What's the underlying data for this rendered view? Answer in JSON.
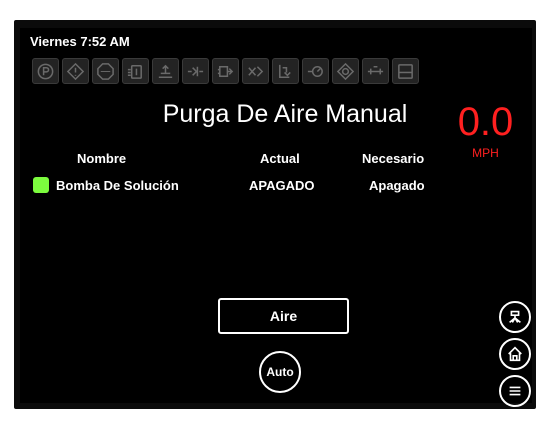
{
  "status_bar": {
    "datetime": "Viernes 7:52 AM"
  },
  "toolbar_icons": [
    "park-icon",
    "warning-icon",
    "stop-icon",
    "tank-agitation-icon",
    "boom-lift-icon",
    "valve-in-icon",
    "valve-out-icon",
    "rinse-icon",
    "fill-icon",
    "pump-icon",
    "gauge-icon",
    "boom-icon",
    "screen-icon"
  ],
  "page": {
    "title": "Purga De Aire Manual"
  },
  "speed": {
    "value": "0.0",
    "unit": "MPH",
    "color": "#ff2020"
  },
  "table": {
    "headers": {
      "name": "Nombre",
      "actual": "Actual",
      "required": "Necesario"
    },
    "rows": [
      {
        "name": "Bomba De Solución",
        "actual": "APAGADO",
        "required": "Apagado",
        "status_color": "#7cfc3e"
      }
    ]
  },
  "buttons": {
    "aire": "Aire",
    "auto": "Auto"
  },
  "side_buttons": [
    "sprayer-icon",
    "home-icon",
    "menu-icon"
  ]
}
